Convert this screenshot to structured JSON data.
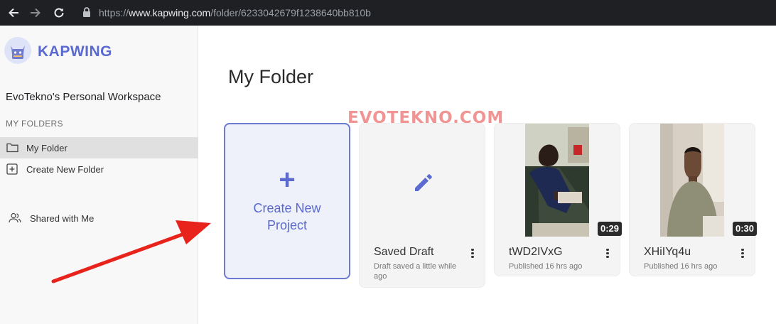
{
  "browser": {
    "url_scheme": "https://",
    "url_host": "www.kapwing.com",
    "url_path": "/folder/6233042679f1238640bb810b"
  },
  "sidebar": {
    "brand": "KAPWING",
    "workspace": "EvoTekno's Personal Workspace",
    "section_label": "MY FOLDERS",
    "items": [
      {
        "label": "My Folder",
        "icon": "folder-icon",
        "active": true
      },
      {
        "label": "Create New Folder",
        "icon": "plus-square-icon",
        "active": false
      }
    ],
    "shared": {
      "label": "Shared with Me",
      "icon": "users-icon"
    }
  },
  "main": {
    "title": "My Folder",
    "watermark": "EVOTEKNO.COM",
    "create_card": {
      "plus": "+",
      "label_line1": "Create New",
      "label_line2": "Project"
    },
    "projects": [
      {
        "title": "Saved Draft",
        "subtitle": "Draft saved a little while ago",
        "type": "draft",
        "icon": "pencil-icon"
      },
      {
        "title": "tWD2IVxG",
        "subtitle": "Published 16 hrs ago",
        "type": "video",
        "duration": "0:29"
      },
      {
        "title": "XHiIYq4u",
        "subtitle": "Published 16 hrs ago",
        "type": "video",
        "duration": "0:30"
      }
    ]
  },
  "colors": {
    "accent": "#5a6acf",
    "annotation_arrow": "#e8231c"
  }
}
